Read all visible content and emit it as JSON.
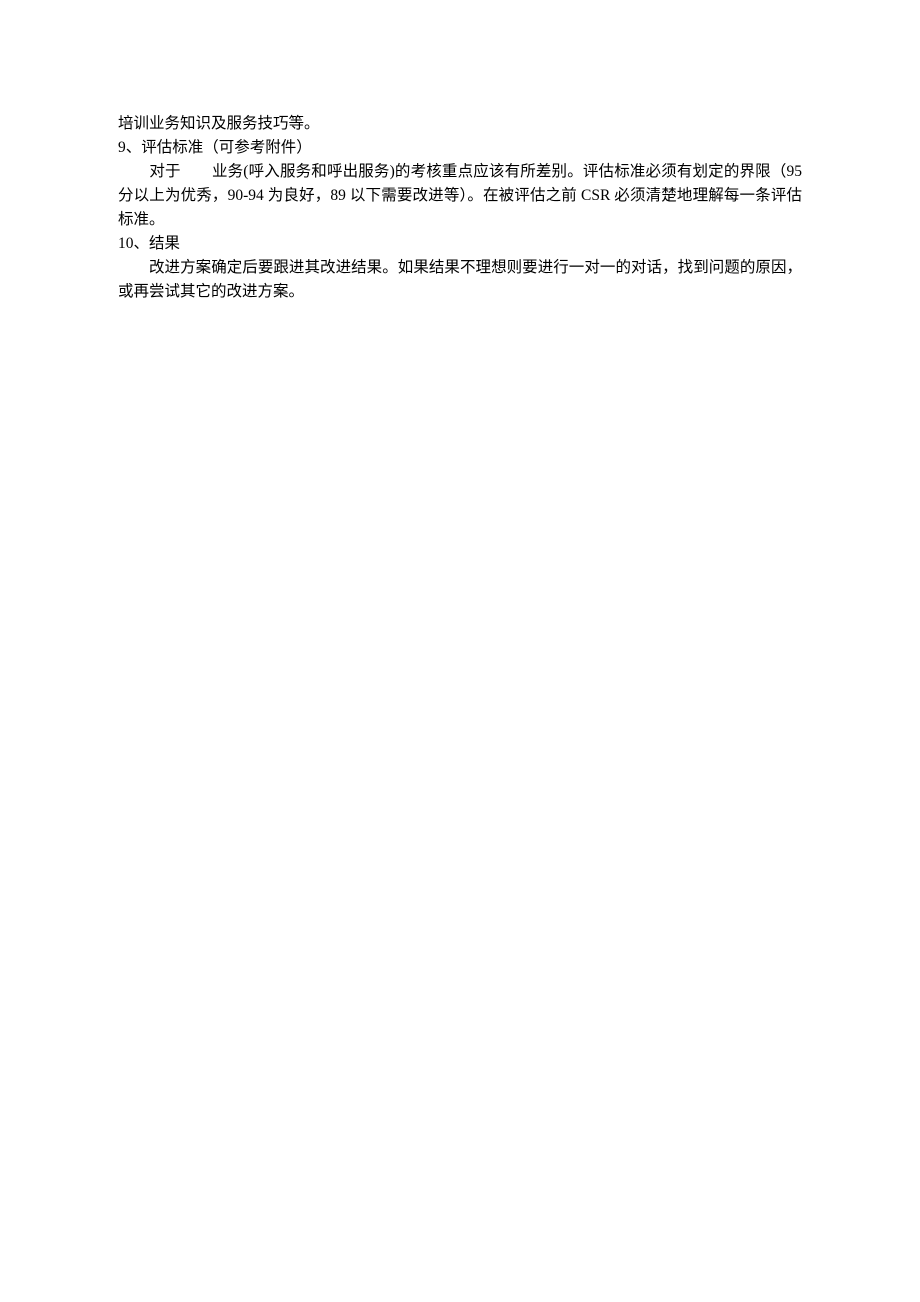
{
  "paragraphs": {
    "p1": "培训业务知识及服务技巧等。",
    "p2_heading": "9、评估标准（可参考附件）",
    "p3_prefix": "对于",
    "p3_rest": "业务(呼入服务和呼出服务)的考核重点应该有所差别。评估标准必须有划定的界限（95 分以上为优秀，90-94 为良好，89 以下需要改进等）。在被评估之前 CSR 必须清楚地理解每一条评估标准。",
    "p4_heading": "10、结果",
    "p5": "改进方案确定后要跟进其改进结果。如果结果不理想则要进行一对一的对话，找到问题的原因，或再尝试其它的改进方案。"
  }
}
